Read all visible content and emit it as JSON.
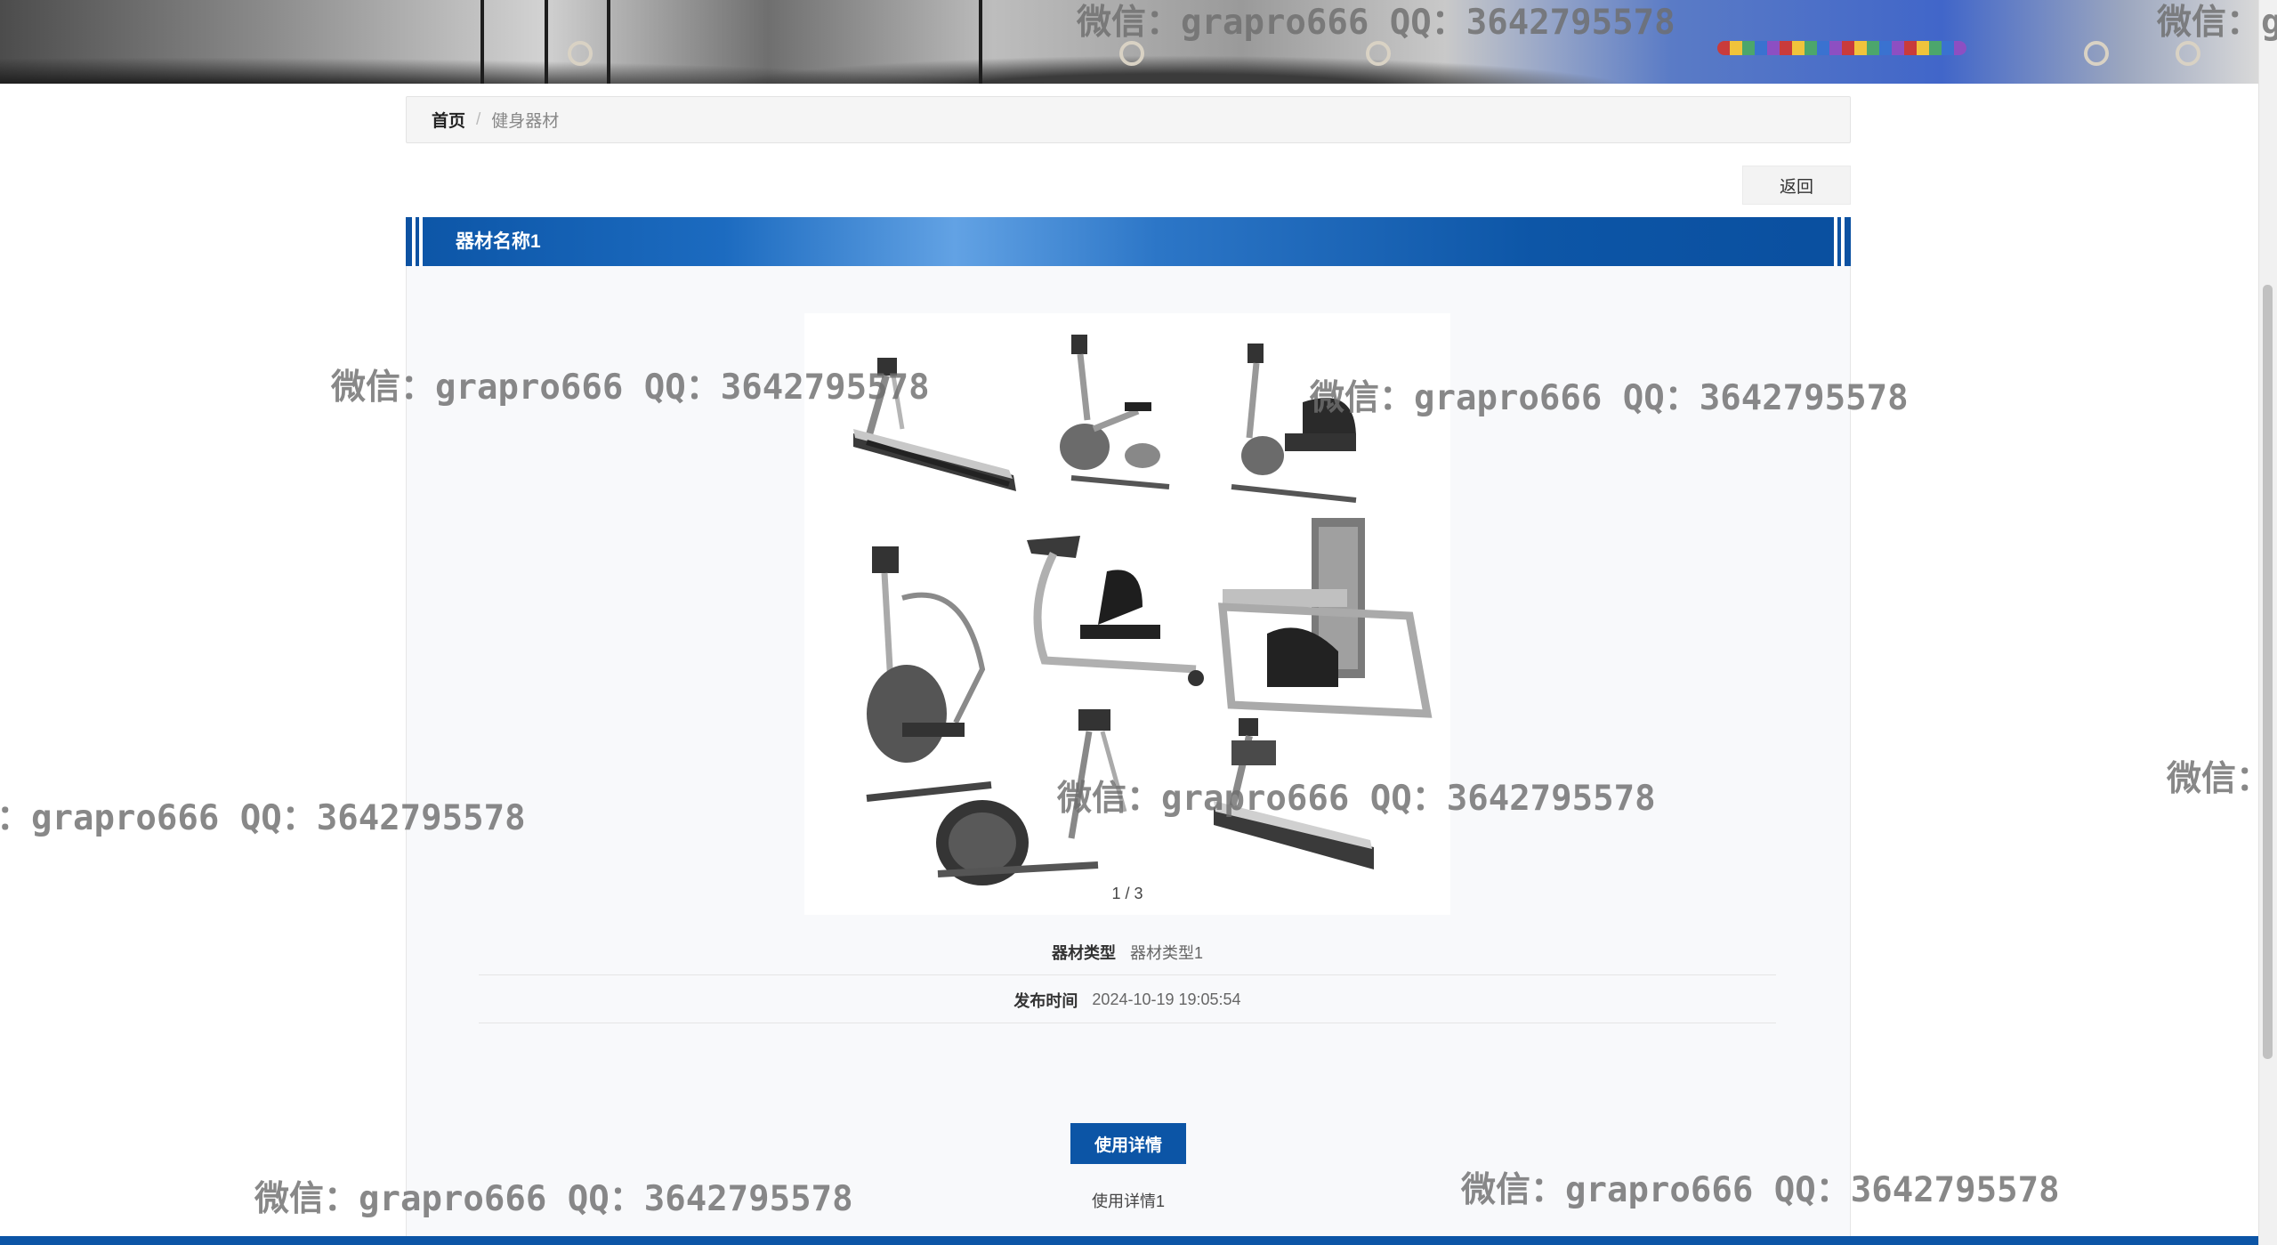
{
  "breadcrumb": {
    "home": "首页",
    "separator": "/",
    "current": "健身器材"
  },
  "actions": {
    "back_label": "返回"
  },
  "item": {
    "title": "器材名称1",
    "image_counter": "1 / 3",
    "fields": [
      {
        "label": "器材类型",
        "value": "器材类型1"
      },
      {
        "label": "发布时间",
        "value": "2024-10-19 19:05:54"
      }
    ],
    "detail_button_label": "使用详情",
    "detail_text": "使用详情1"
  },
  "watermark": {
    "full": "微信：grapro666 QQ：3642795578",
    "partial_left": "：grapro666 QQ：3642795578",
    "partial_right": "微信：",
    "partial_top": "微信：grapro666 QQ：3642795578",
    "partial_corner": "微信：g"
  },
  "colors": {
    "primary": "#0c55a6",
    "background": "#f8f9fb"
  }
}
